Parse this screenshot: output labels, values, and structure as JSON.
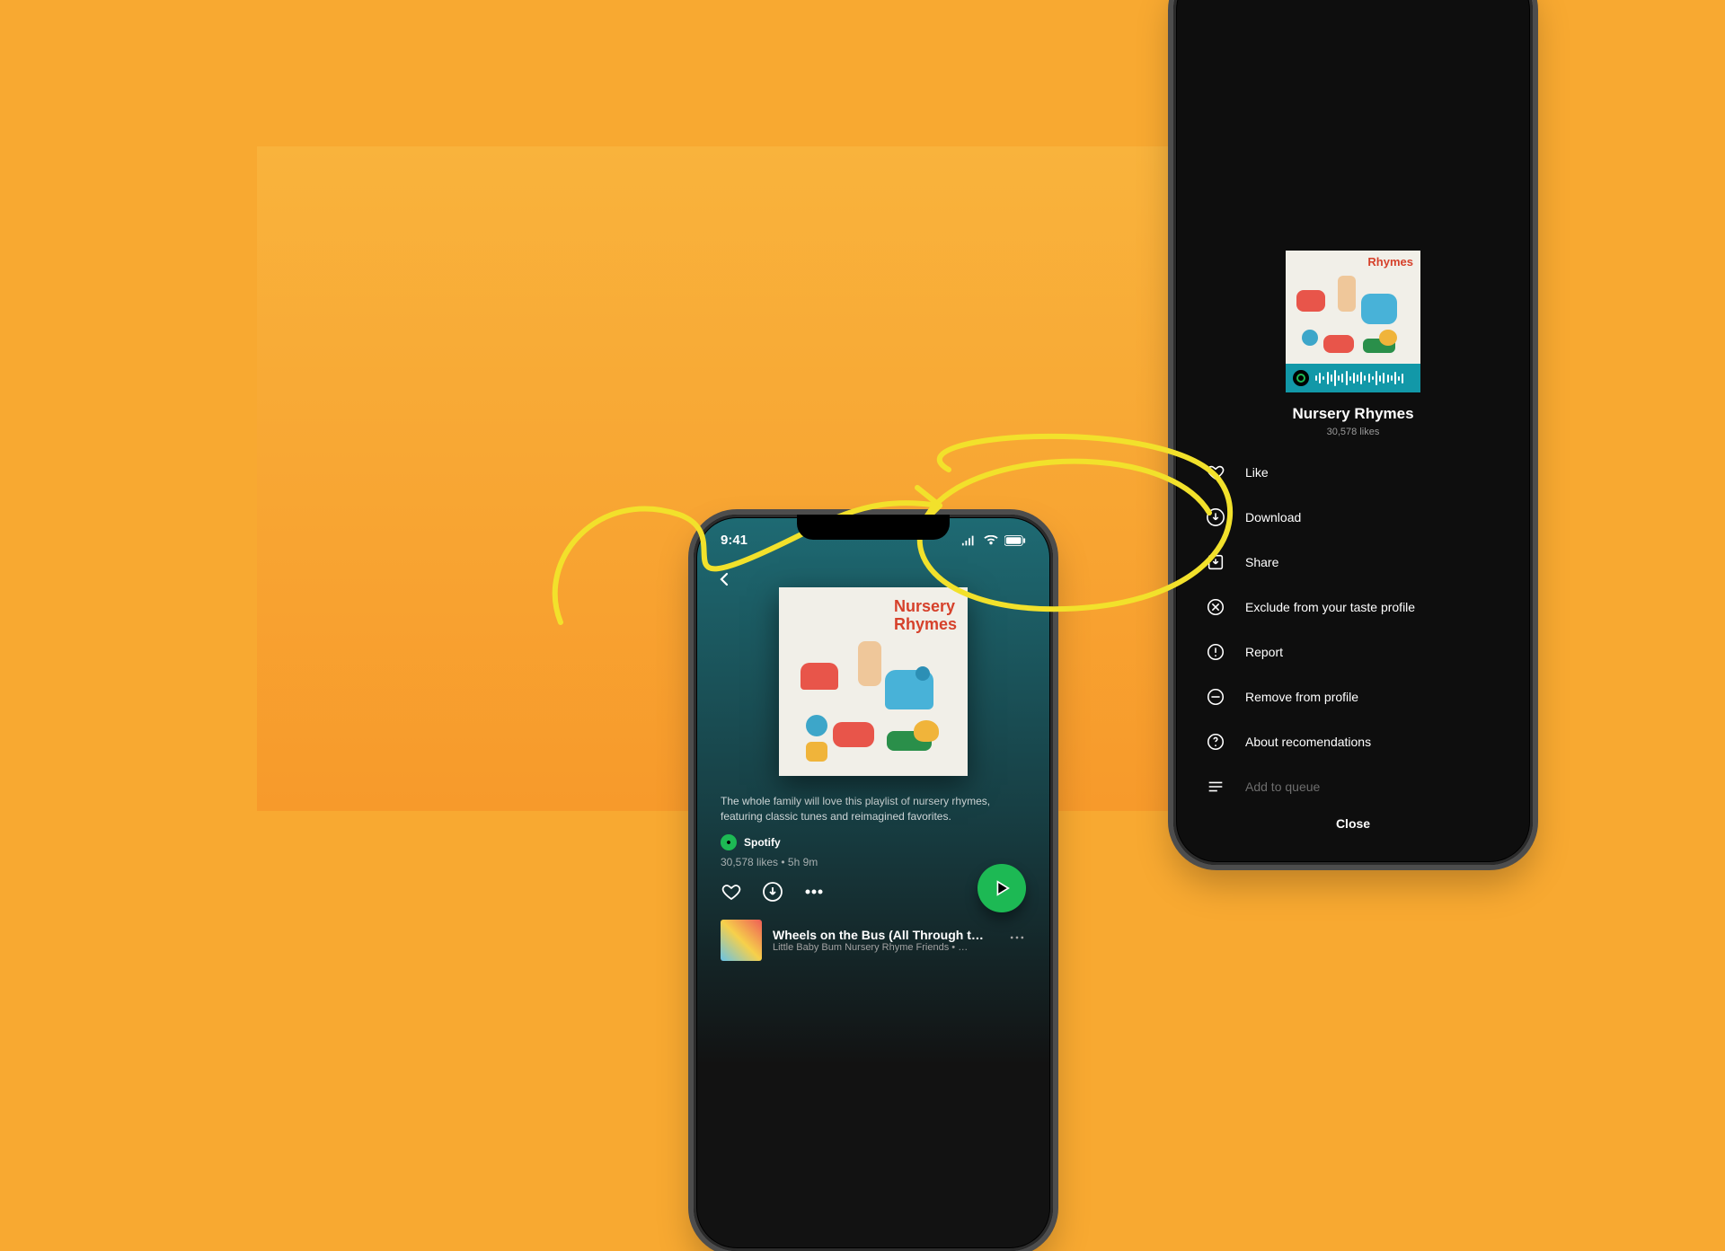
{
  "inset_bg": "#f9b33c",
  "left_phone": {
    "status_time": "9:41",
    "playlist": {
      "cover_title_line1": "Nursery",
      "cover_title_line2": "Rhymes",
      "description": "The whole family will love this playlist of nursery rhymes, featuring classic tunes and reimagined favorites.",
      "by_label": "Spotify",
      "likes": "30,578 likes",
      "duration": "5h 9m",
      "likes_sep": " • "
    },
    "first_track": {
      "title": "Wheels on the Bus (All Through t…",
      "subtitle": "Little Baby Bum Nursery Rhyme Friends • …"
    }
  },
  "right_phone": {
    "title": "Nursery Rhymes",
    "likes": "30,578 likes",
    "menu": [
      {
        "key": "like",
        "label": "Like"
      },
      {
        "key": "download",
        "label": "Download"
      },
      {
        "key": "share",
        "label": "Share"
      },
      {
        "key": "exclude",
        "label": "Exclude from your taste profile"
      },
      {
        "key": "report",
        "label": "Report"
      },
      {
        "key": "remove",
        "label": "Remove from profile"
      },
      {
        "key": "about",
        "label": "About recomendations"
      },
      {
        "key": "queue",
        "label": "Add to queue"
      }
    ],
    "close": "Close",
    "cover_title_line2": "Rhymes"
  }
}
